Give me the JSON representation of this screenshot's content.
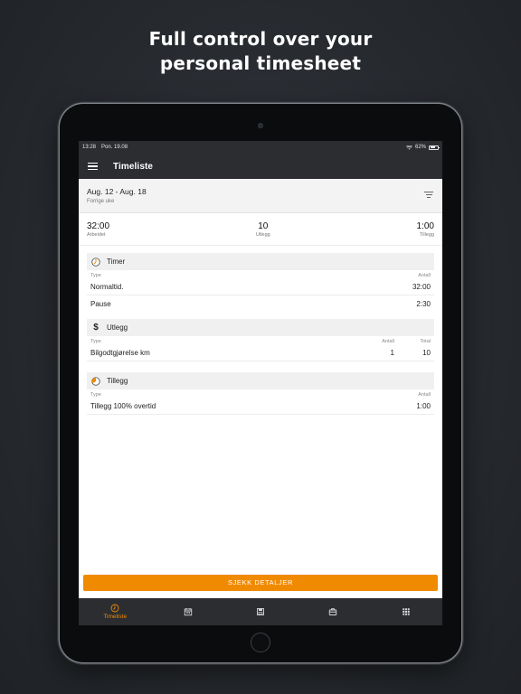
{
  "headline": {
    "line1": "Full control over your",
    "line2": "personal timesheet"
  },
  "status_bar": {
    "time": "13:28",
    "date": "Pon. 19.08",
    "battery": "62%"
  },
  "app_bar": {
    "title": "Timeliste"
  },
  "period": {
    "range": "Aug. 12 - Aug. 18",
    "subtitle": "Forrige uke"
  },
  "summary": [
    {
      "value": "32:00",
      "label": "Arbeidet"
    },
    {
      "value": "10",
      "label": "Utlegg"
    },
    {
      "value": "1:00",
      "label": "Tillegg"
    }
  ],
  "sections": {
    "timer": {
      "title": "Timer",
      "col_type": "Type",
      "col_count": "Antall",
      "rows": [
        {
          "type": "Normaltid.",
          "count": "32:00"
        },
        {
          "type": "Pause",
          "count": "2:30"
        }
      ]
    },
    "utlegg": {
      "title": "Utlegg",
      "col_type": "Type",
      "col_count": "Antall",
      "col_total": "Total",
      "rows": [
        {
          "type": "Bilgodtgjørelse km",
          "count": "1",
          "total": "10"
        }
      ]
    },
    "tillegg": {
      "title": "Tillegg",
      "col_type": "Type",
      "col_count": "Antall",
      "rows": [
        {
          "type": "Tillegg 100% overtid",
          "count": "1:00"
        }
      ]
    }
  },
  "cta": {
    "label": "SJEKK DETALJER"
  },
  "bottom_nav": {
    "items": [
      {
        "label": "Timeliste",
        "icon": "clock-icon",
        "active": true
      },
      {
        "icon": "calendar-icon"
      },
      {
        "icon": "save-icon"
      },
      {
        "icon": "briefcase-icon"
      },
      {
        "icon": "grid-icon"
      }
    ]
  },
  "colors": {
    "accent": "#f08a00",
    "bar": "#2b2d31",
    "background": "#272a2f"
  }
}
